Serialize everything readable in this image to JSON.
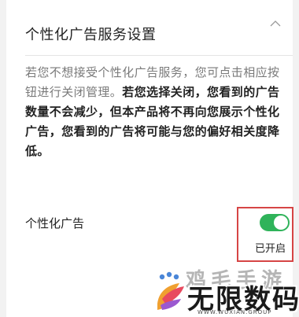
{
  "section": {
    "title": "个性化广告服务设置",
    "collapse_icon": "chevron-up-icon"
  },
  "description": {
    "normal": "若您不想接受个性化广告服务，您可点击相应按钮进行关闭管理。",
    "bold": "若您选择关闭，您看到的广告数量不会减少，但本产品将不再向您展示个性化广告，您看到的广告将可能与您的偏好相关度降低。"
  },
  "setting": {
    "label": "个性化广告",
    "toggle_on": true,
    "status": "已开启",
    "accent_color": "#2fb35a",
    "highlight_color": "#d64545"
  },
  "watermark": {
    "top_text": "鸡毛手游",
    "main_text": "无限数码",
    "url": "WWW.WUXIAN.GROUP"
  }
}
